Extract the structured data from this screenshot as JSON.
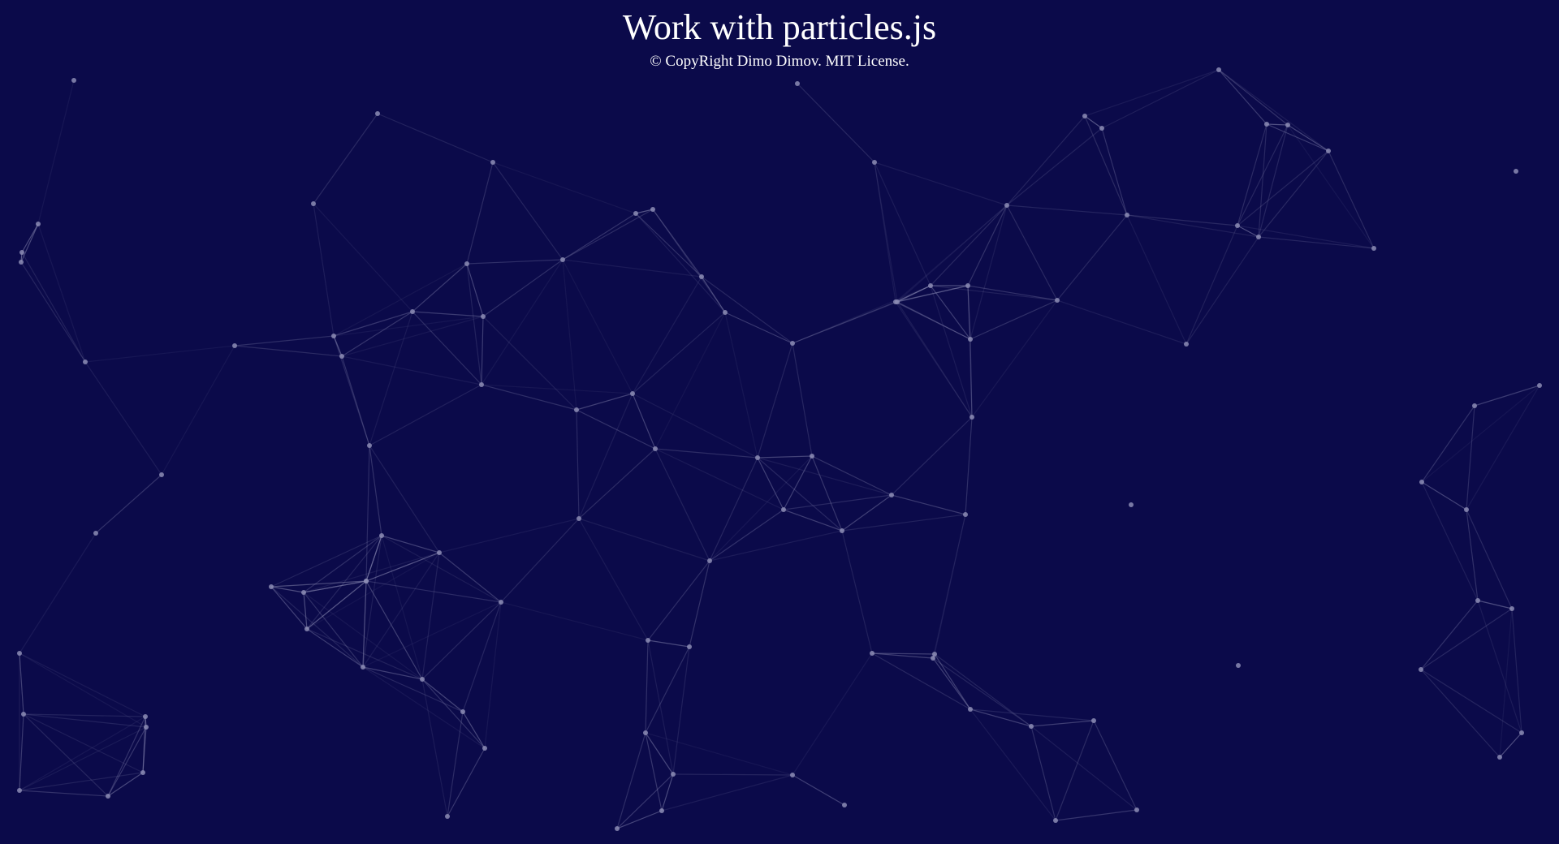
{
  "page": {
    "title": "Work with particles.js",
    "copyright": "© CopyRight Dimo Dimov. MIT License."
  },
  "theme": {
    "background": "#0b0a4a",
    "particle_color": "#8c8cb4",
    "link_color": "#8c8cb4",
    "text_color": "#ffffff"
  }
}
